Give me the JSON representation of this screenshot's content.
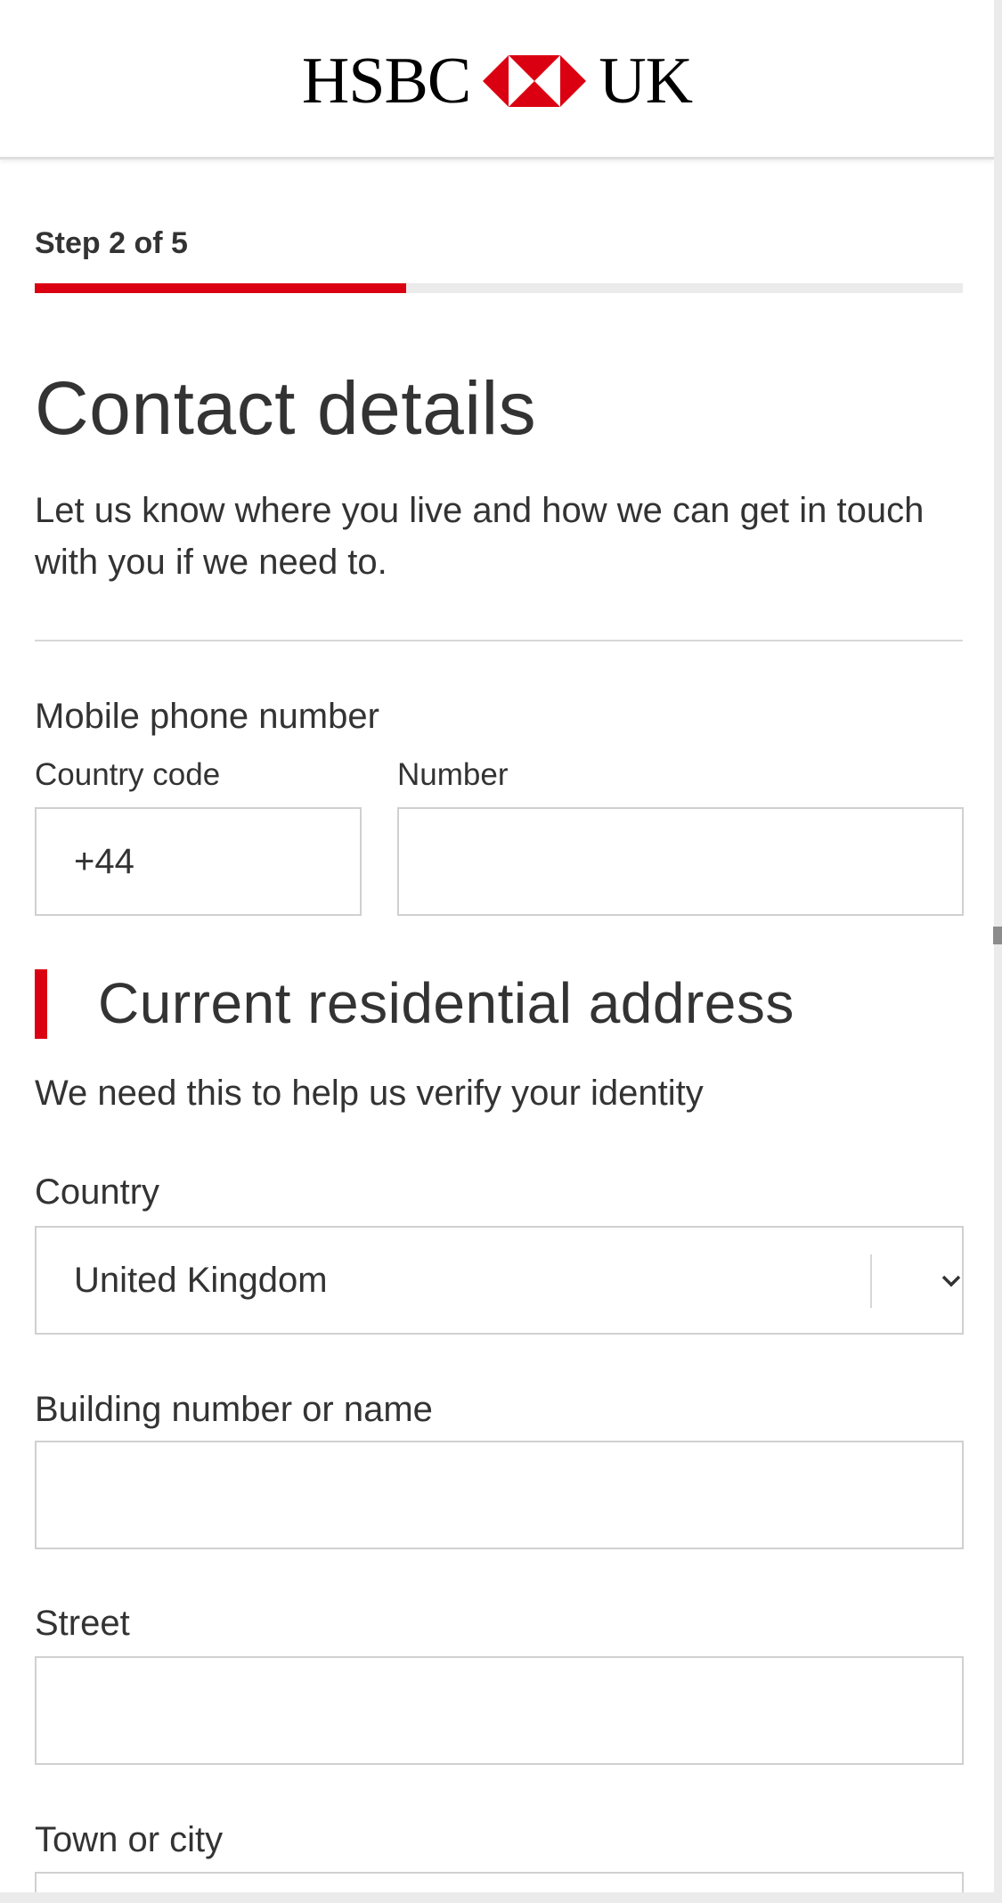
{
  "header": {
    "brand_left": "HSBC",
    "brand_right": "UK",
    "logo_icon": "hsbc-hexagon-logo",
    "brand_color": "#db0011"
  },
  "progress": {
    "step_label": "Step 2 of 5",
    "current_step": 2,
    "total_steps": 5,
    "fill_fraction": 0.4
  },
  "page": {
    "title": "Contact details",
    "intro": "Let us know where you live and how we can get in touch with you if we need to."
  },
  "mobile": {
    "label": "Mobile phone number",
    "country_code_label": "Country code",
    "country_code_value": "+44",
    "number_label": "Number",
    "number_value": ""
  },
  "address": {
    "section_title": "Current residential address",
    "section_desc": "We need this to help us verify your identity",
    "country_label": "Country",
    "country_value": "United Kingdom",
    "country_icon": "chevron-down-icon",
    "building_label": "Building number or name",
    "building_value": "",
    "street_label": "Street",
    "street_value": "",
    "town_label": "Town or city",
    "town_value": ""
  }
}
